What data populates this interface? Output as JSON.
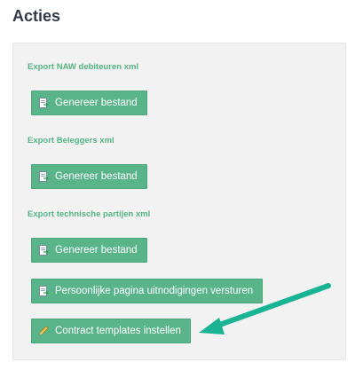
{
  "page": {
    "title": "Acties"
  },
  "sections": [
    {
      "label": "Export NAW debiteuren xml",
      "button": "Genereer bestand"
    },
    {
      "label": "Export Beleggers xml",
      "button": "Genereer bestand"
    },
    {
      "label": "Export technische partijen xml",
      "button": "Genereer bestand"
    }
  ],
  "extra_buttons": [
    {
      "label": "Persoonlijke pagina uitnodigingen versturen",
      "icon": "file-export-icon"
    },
    {
      "label": "Contract templates instellen",
      "icon": "pencil-icon"
    }
  ],
  "colors": {
    "accent": "#5ab48a",
    "arrow": "#1ab394",
    "label": "#55b585"
  }
}
